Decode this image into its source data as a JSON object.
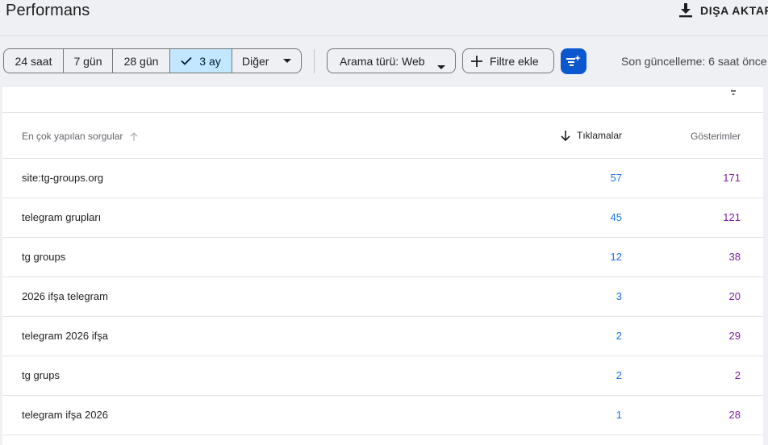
{
  "header": {
    "title": "Performans",
    "export_label": "DIŞA AKTAR",
    "export_icon": "download-icon"
  },
  "date_range": {
    "options": [
      "24 saat",
      "7 gün",
      "28 gün",
      "3 ay",
      "Diğer"
    ],
    "selected": "3 ay"
  },
  "filters": {
    "search_type_label": "Arama türü: Web",
    "add_filter_label": "Filtre ekle",
    "tune_icon": "tune-sparkle-icon",
    "last_update": "Son güncelleme: 6 saat önce"
  },
  "table": {
    "columns": {
      "query": "En çok yapılan sorgular",
      "clicks": "Tıklamalar",
      "impressions": "Gösterimler"
    },
    "sorted_by": "clicks",
    "sort_direction": "desc",
    "rows": [
      {
        "query": "site:tg-groups.org",
        "clicks": "57",
        "impressions": "171"
      },
      {
        "query": "telegram grupları",
        "clicks": "45",
        "impressions": "121"
      },
      {
        "query": "tg groups",
        "clicks": "12",
        "impressions": "38"
      },
      {
        "query": "2026 ifşa telegram",
        "clicks": "3",
        "impressions": "20"
      },
      {
        "query": "telegram 2026 ifşa",
        "clicks": "2",
        "impressions": "29"
      },
      {
        "query": "tg grups",
        "clicks": "2",
        "impressions": "2"
      },
      {
        "query": "telegram ifşa 2026",
        "clicks": "1",
        "impressions": "28"
      }
    ]
  },
  "colors": {
    "accent": "#0b57d0",
    "selected_segment": "#c2e7ff",
    "clicks": "#1a73e8",
    "impressions": "#7b1fa2"
  }
}
